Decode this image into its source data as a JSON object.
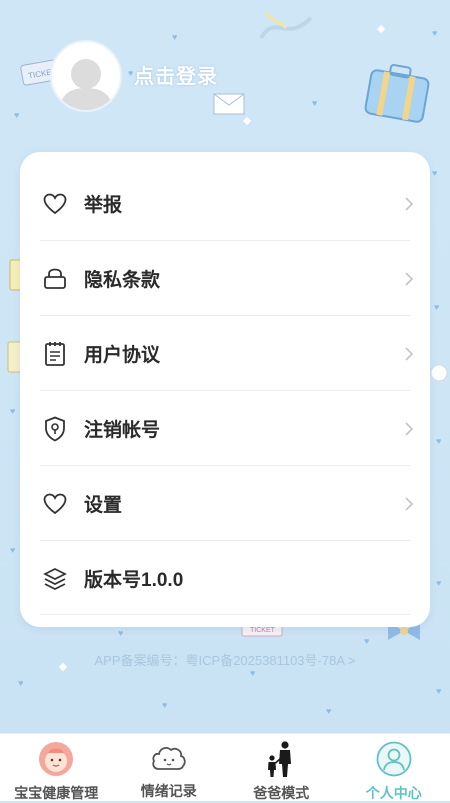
{
  "header": {
    "login_label": "点击登录"
  },
  "menu": [
    {
      "label": "举报",
      "icon": "heart-icon"
    },
    {
      "label": "隐私条款",
      "icon": "lock-icon"
    },
    {
      "label": "用户协议",
      "icon": "notepad-icon"
    },
    {
      "label": "注销帐号",
      "icon": "shield-icon"
    },
    {
      "label": "设置",
      "icon": "heart-icon"
    },
    {
      "label": "版本号1.0.0",
      "icon": "layers-icon"
    }
  ],
  "footer": {
    "icp_text": "APP备案编号：粤ICP备2025381103号-78A >"
  },
  "tabbar": {
    "tabs": [
      {
        "label": "宝宝健康管理",
        "icon": "baby-face-icon"
      },
      {
        "label": "情绪记录",
        "icon": "cloud-face-icon"
      },
      {
        "label": "爸爸模式",
        "icon": "father-child-icon"
      },
      {
        "label": "个人中心",
        "icon": "user-icon"
      }
    ],
    "active_index": 3
  },
  "colors": {
    "background": "#cde5f5",
    "active_tab": "#5cc3c0",
    "icp_text": "#a8c6de"
  }
}
